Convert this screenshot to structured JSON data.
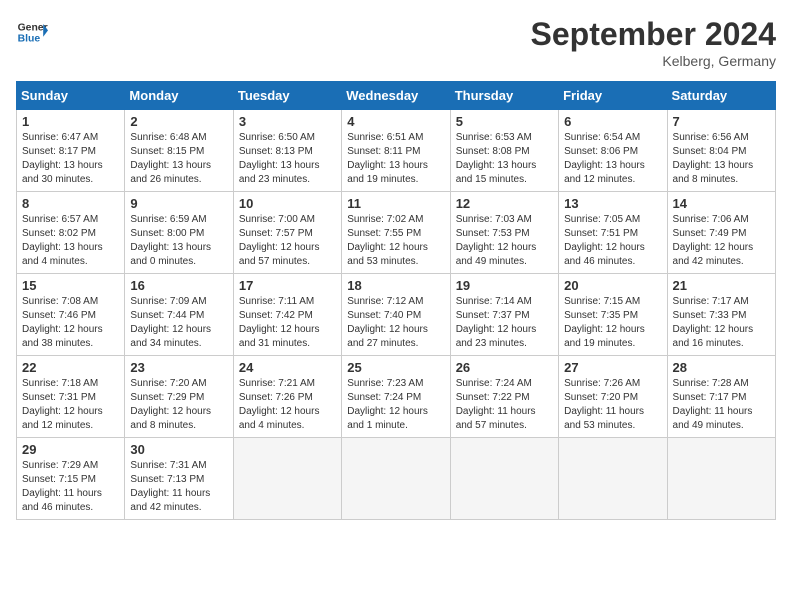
{
  "header": {
    "logo_line1": "General",
    "logo_line2": "Blue",
    "month_year": "September 2024",
    "location": "Kelberg, Germany"
  },
  "days_of_week": [
    "Sunday",
    "Monday",
    "Tuesday",
    "Wednesday",
    "Thursday",
    "Friday",
    "Saturday"
  ],
  "weeks": [
    [
      {
        "day": 1,
        "lines": [
          "Sunrise: 6:47 AM",
          "Sunset: 8:17 PM",
          "Daylight: 13 hours",
          "and 30 minutes."
        ]
      },
      {
        "day": 2,
        "lines": [
          "Sunrise: 6:48 AM",
          "Sunset: 8:15 PM",
          "Daylight: 13 hours",
          "and 26 minutes."
        ]
      },
      {
        "day": 3,
        "lines": [
          "Sunrise: 6:50 AM",
          "Sunset: 8:13 PM",
          "Daylight: 13 hours",
          "and 23 minutes."
        ]
      },
      {
        "day": 4,
        "lines": [
          "Sunrise: 6:51 AM",
          "Sunset: 8:11 PM",
          "Daylight: 13 hours",
          "and 19 minutes."
        ]
      },
      {
        "day": 5,
        "lines": [
          "Sunrise: 6:53 AM",
          "Sunset: 8:08 PM",
          "Daylight: 13 hours",
          "and 15 minutes."
        ]
      },
      {
        "day": 6,
        "lines": [
          "Sunrise: 6:54 AM",
          "Sunset: 8:06 PM",
          "Daylight: 13 hours",
          "and 12 minutes."
        ]
      },
      {
        "day": 7,
        "lines": [
          "Sunrise: 6:56 AM",
          "Sunset: 8:04 PM",
          "Daylight: 13 hours",
          "and 8 minutes."
        ]
      }
    ],
    [
      {
        "day": 8,
        "lines": [
          "Sunrise: 6:57 AM",
          "Sunset: 8:02 PM",
          "Daylight: 13 hours",
          "and 4 minutes."
        ]
      },
      {
        "day": 9,
        "lines": [
          "Sunrise: 6:59 AM",
          "Sunset: 8:00 PM",
          "Daylight: 13 hours",
          "and 0 minutes."
        ]
      },
      {
        "day": 10,
        "lines": [
          "Sunrise: 7:00 AM",
          "Sunset: 7:57 PM",
          "Daylight: 12 hours",
          "and 57 minutes."
        ]
      },
      {
        "day": 11,
        "lines": [
          "Sunrise: 7:02 AM",
          "Sunset: 7:55 PM",
          "Daylight: 12 hours",
          "and 53 minutes."
        ]
      },
      {
        "day": 12,
        "lines": [
          "Sunrise: 7:03 AM",
          "Sunset: 7:53 PM",
          "Daylight: 12 hours",
          "and 49 minutes."
        ]
      },
      {
        "day": 13,
        "lines": [
          "Sunrise: 7:05 AM",
          "Sunset: 7:51 PM",
          "Daylight: 12 hours",
          "and 46 minutes."
        ]
      },
      {
        "day": 14,
        "lines": [
          "Sunrise: 7:06 AM",
          "Sunset: 7:49 PM",
          "Daylight: 12 hours",
          "and 42 minutes."
        ]
      }
    ],
    [
      {
        "day": 15,
        "lines": [
          "Sunrise: 7:08 AM",
          "Sunset: 7:46 PM",
          "Daylight: 12 hours",
          "and 38 minutes."
        ]
      },
      {
        "day": 16,
        "lines": [
          "Sunrise: 7:09 AM",
          "Sunset: 7:44 PM",
          "Daylight: 12 hours",
          "and 34 minutes."
        ]
      },
      {
        "day": 17,
        "lines": [
          "Sunrise: 7:11 AM",
          "Sunset: 7:42 PM",
          "Daylight: 12 hours",
          "and 31 minutes."
        ]
      },
      {
        "day": 18,
        "lines": [
          "Sunrise: 7:12 AM",
          "Sunset: 7:40 PM",
          "Daylight: 12 hours",
          "and 27 minutes."
        ]
      },
      {
        "day": 19,
        "lines": [
          "Sunrise: 7:14 AM",
          "Sunset: 7:37 PM",
          "Daylight: 12 hours",
          "and 23 minutes."
        ]
      },
      {
        "day": 20,
        "lines": [
          "Sunrise: 7:15 AM",
          "Sunset: 7:35 PM",
          "Daylight: 12 hours",
          "and 19 minutes."
        ]
      },
      {
        "day": 21,
        "lines": [
          "Sunrise: 7:17 AM",
          "Sunset: 7:33 PM",
          "Daylight: 12 hours",
          "and 16 minutes."
        ]
      }
    ],
    [
      {
        "day": 22,
        "lines": [
          "Sunrise: 7:18 AM",
          "Sunset: 7:31 PM",
          "Daylight: 12 hours",
          "and 12 minutes."
        ]
      },
      {
        "day": 23,
        "lines": [
          "Sunrise: 7:20 AM",
          "Sunset: 7:29 PM",
          "Daylight: 12 hours",
          "and 8 minutes."
        ]
      },
      {
        "day": 24,
        "lines": [
          "Sunrise: 7:21 AM",
          "Sunset: 7:26 PM",
          "Daylight: 12 hours",
          "and 4 minutes."
        ]
      },
      {
        "day": 25,
        "lines": [
          "Sunrise: 7:23 AM",
          "Sunset: 7:24 PM",
          "Daylight: 12 hours",
          "and 1 minute."
        ]
      },
      {
        "day": 26,
        "lines": [
          "Sunrise: 7:24 AM",
          "Sunset: 7:22 PM",
          "Daylight: 11 hours",
          "and 57 minutes."
        ]
      },
      {
        "day": 27,
        "lines": [
          "Sunrise: 7:26 AM",
          "Sunset: 7:20 PM",
          "Daylight: 11 hours",
          "and 53 minutes."
        ]
      },
      {
        "day": 28,
        "lines": [
          "Sunrise: 7:28 AM",
          "Sunset: 7:17 PM",
          "Daylight: 11 hours",
          "and 49 minutes."
        ]
      }
    ],
    [
      {
        "day": 29,
        "lines": [
          "Sunrise: 7:29 AM",
          "Sunset: 7:15 PM",
          "Daylight: 11 hours",
          "and 46 minutes."
        ]
      },
      {
        "day": 30,
        "lines": [
          "Sunrise: 7:31 AM",
          "Sunset: 7:13 PM",
          "Daylight: 11 hours",
          "and 42 minutes."
        ]
      },
      null,
      null,
      null,
      null,
      null
    ]
  ]
}
